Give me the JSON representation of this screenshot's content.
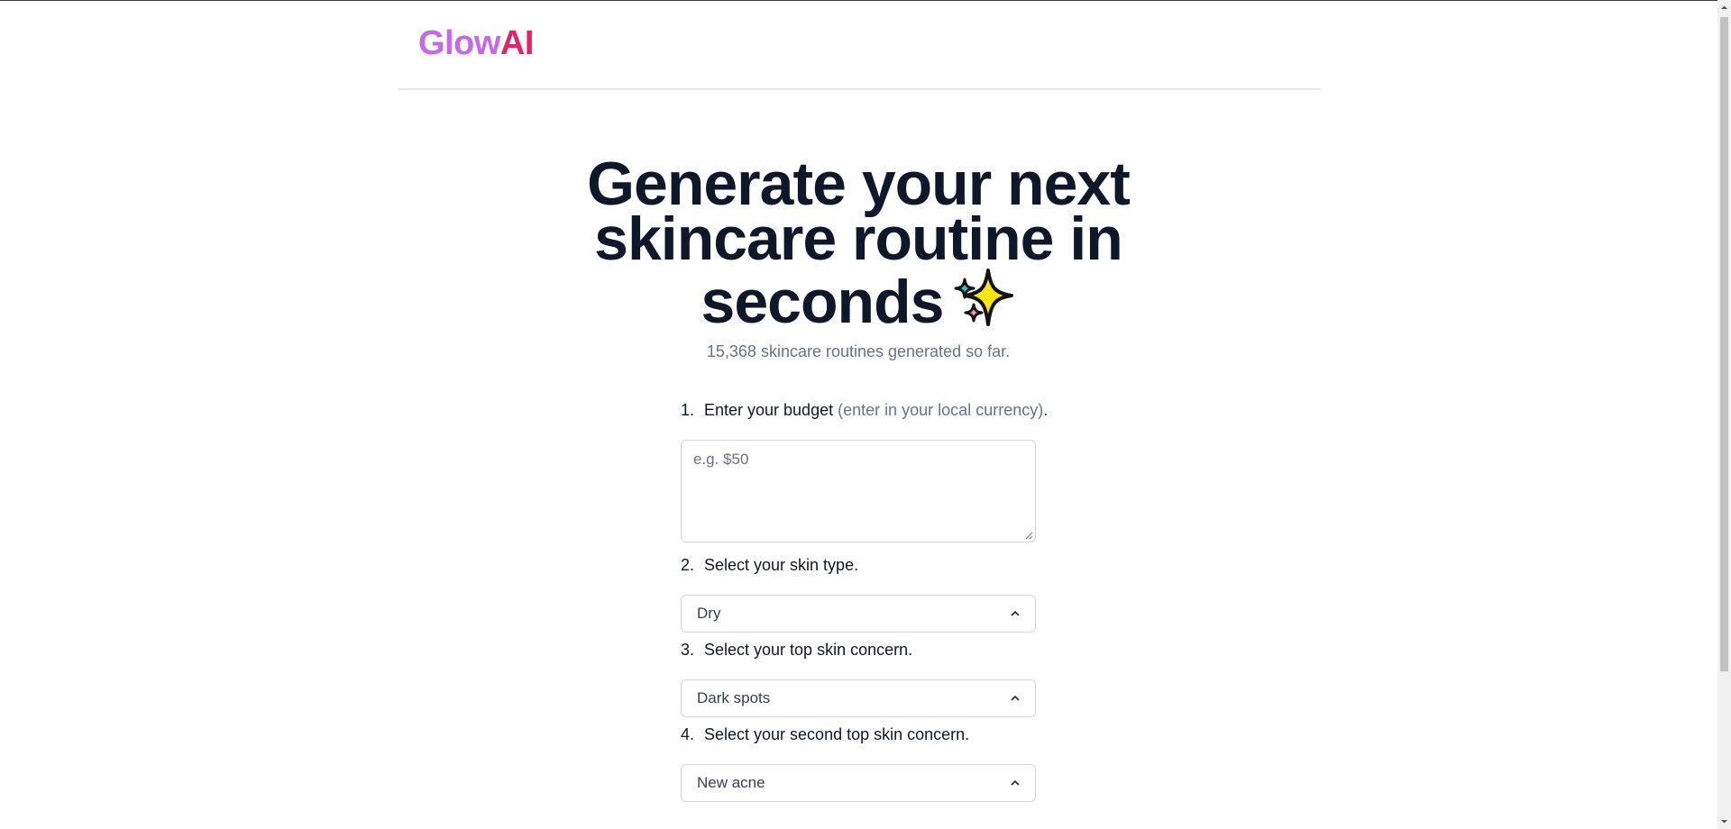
{
  "brand": {
    "logo_part1": "Glow",
    "logo_part2": "AI",
    "colors": {
      "glow": "#c46ae6",
      "ai": "#e0246d"
    }
  },
  "hero": {
    "title": "Generate your next skincare routine in seconds",
    "sparkle_icon": "sparkles-icon",
    "subtitle": "15,368 skincare routines generated so far."
  },
  "form": {
    "steps": [
      {
        "num": "1.",
        "label": "Enter your budget",
        "hint": "(enter in your local currency)",
        "suffix": "."
      },
      {
        "num": "2.",
        "label": "Select your skin type."
      },
      {
        "num": "3.",
        "label": "Select your top skin concern."
      },
      {
        "num": "4.",
        "label": "Select your second top skin concern."
      }
    ],
    "budget": {
      "value": "",
      "placeholder": "e.g. $50"
    },
    "skin_type": {
      "selected": "Dry"
    },
    "top_concern": {
      "selected": "Dark spots"
    },
    "second_concern": {
      "selected": "New acne"
    }
  }
}
